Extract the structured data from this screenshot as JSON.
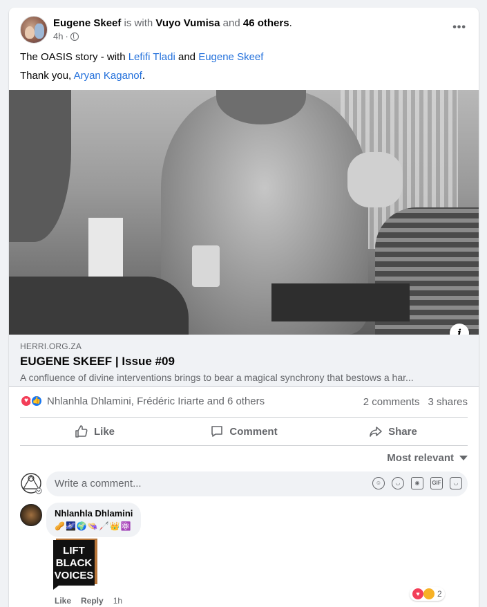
{
  "post": {
    "author": "Eugene Skeef",
    "with_text": "is with",
    "tagged": "Vuyo Vumisa",
    "and_text": "and",
    "others": "46 others",
    "period": ".",
    "time": "4h",
    "dot": "·",
    "line1_prefix": "The OASIS story - with ",
    "line1_link1": "Lefifi Tladi",
    "line1_and": " and ",
    "line1_link2": "Eugene Skeef",
    "line2_prefix": "Thank you, ",
    "line2_link": "Aryan Kaganof",
    "line2_suffix": "."
  },
  "link_preview": {
    "source": "HERRI.ORG.ZA",
    "title": "EUGENE SKEEF | Issue #09",
    "description": "A confluence of divine interventions brings to bear a magical synchrony that bestows a har..."
  },
  "stats": {
    "reactors": "Nhlanhla Dhlamini, Frédéric Iriarte and 6 others",
    "comments": "2 comments",
    "shares": "3 shares"
  },
  "actions": {
    "like": "Like",
    "comment": "Comment",
    "share": "Share"
  },
  "comments": {
    "sort": "Most relevant",
    "placeholder": "Write a comment...",
    "input_icons": [
      "avatar-sticker-icon",
      "emoji-icon",
      "camera-icon",
      "gif-icon",
      "sticker-icon"
    ],
    "items": [
      {
        "author": "Nhlanhla Dhlamini",
        "emojis": "🥜🌌🌍👒🦯👑⚛️",
        "sticker_text": [
          "LIFT",
          "BLACK",
          "VOICES"
        ],
        "like": "Like",
        "reply": "Reply",
        "time": "1h",
        "reaction_count": "2"
      }
    ]
  },
  "colors": {
    "link": "#216fdb",
    "love": "#f33e58",
    "like": "#1877f2",
    "muted": "#65676b"
  }
}
